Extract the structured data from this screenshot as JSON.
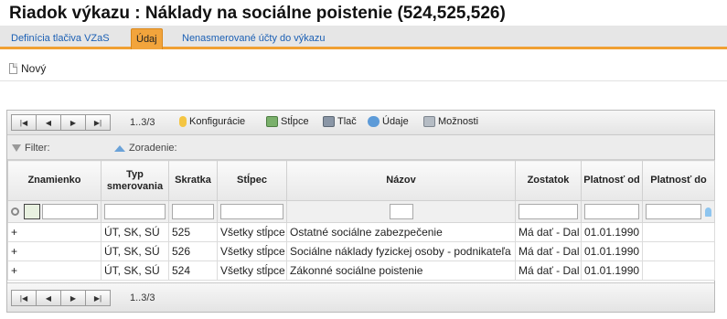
{
  "page": {
    "title": "Riadok výkazu :  Náklady na sociálne poistenie (524,525,526)"
  },
  "tabs": [
    {
      "label": "Definícia tlačiva VZaS"
    },
    {
      "label": "Údaj"
    },
    {
      "label": "Nenasmerované účty do výkazu"
    }
  ],
  "toolbar": {
    "new_label": "Nový"
  },
  "grid": {
    "count_label": "1..3/3",
    "tools": {
      "config": "Konfigurácie",
      "columns": "Stĺpce",
      "print": "Tlač",
      "data": "Údaje",
      "options": "Možnosti"
    },
    "filter_label": "Filter:",
    "sort_label": "Zoradenie:",
    "columns": [
      {
        "label": "Znamienko"
      },
      {
        "label": "Typ smerovania"
      },
      {
        "label": "Skratka"
      },
      {
        "label": "Stĺpec"
      },
      {
        "label": "Názov"
      },
      {
        "label": "Zostatok"
      },
      {
        "label": "Platnosť od"
      },
      {
        "label": "Platnosť do"
      }
    ],
    "rows": [
      {
        "sign": "+",
        "type": "ÚT, SK, SÚ",
        "code": "525",
        "column": "Všetky stĺpce",
        "name": "Ostatné sociálne zabezpečenie",
        "balance": "Má dať - Dal",
        "from": "01.01.1990",
        "to": ""
      },
      {
        "sign": "+",
        "type": "ÚT, SK, SÚ",
        "code": "526",
        "column": "Všetky stĺpce",
        "name": "Sociálne náklady fyzickej osoby - podnikateľa",
        "balance": "Má dať - Dal",
        "from": "01.01.1990",
        "to": ""
      },
      {
        "sign": "+",
        "type": "ÚT, SK, SÚ",
        "code": "524",
        "column": "Všetky stĺpce",
        "name": "Zákonné sociálne poistenie",
        "balance": "Má dať - Dal",
        "from": "01.01.1990",
        "to": ""
      }
    ]
  },
  "colors": {
    "accent": "#f2a43c",
    "link": "#1a5fb4"
  }
}
